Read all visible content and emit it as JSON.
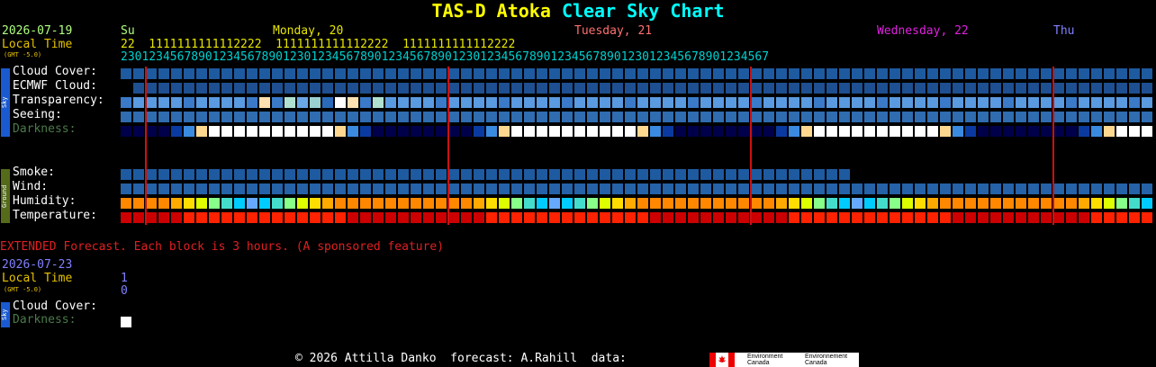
{
  "title": {
    "part1": "TAS-D Atoka",
    "part2": "Clear Sky Chart"
  },
  "header": {
    "date": "2026-07-19",
    "local_time": "Local Time",
    "gmt": "(GMT -5.0)",
    "days": [
      {
        "label": "Su",
        "color": "#b0ff80"
      },
      {
        "label": "Monday, 20",
        "color": "#e6e600"
      },
      {
        "label": "Tuesday, 21",
        "color": "#ff7070"
      },
      {
        "label": "Wednesday, 22",
        "color": "#e020e0"
      },
      {
        "label": "Thu",
        "color": "#8080ff"
      }
    ],
    "tens": "22  1111111111112222  1111111111112222  1111111111112222",
    "units": "23012345678901234567890123012345678901234567890123012345678901234567890123012345678901234567"
  },
  "rows": {
    "sky": [
      {
        "label": "Cloud Cover:",
        "key": "cloud"
      },
      {
        "label": "ECMWF Cloud:",
        "key": "ecmwf"
      },
      {
        "label": "Transparency:",
        "key": "transp"
      },
      {
        "label": "Seeing:",
        "key": "seeing"
      },
      {
        "label": "Darkness:",
        "key": "dark"
      }
    ],
    "ground": [
      {
        "label": "Smoke:",
        "key": "smoke"
      },
      {
        "label": "Wind:",
        "key": "wind"
      },
      {
        "label": "Humidity:",
        "key": "humid"
      },
      {
        "label": "Temperature:",
        "key": "temp"
      }
    ],
    "side_sky": "Sky",
    "side_ground": "Ground"
  },
  "palette": {
    "cloud": "#1e5aa0",
    "ecmwf": "#1e4f90",
    "seeing": "#2f6cb0",
    "smoke": "#1e5aa0",
    "wind": "#2562a8",
    "temp": "#ff2200"
  },
  "extended": {
    "note": "EXTENDED Forecast. Each block is 3 hours. (A sponsored feature)",
    "date": "2026-07-23",
    "local_time": "Local Time",
    "gmt": "(GMT -5.0)",
    "hour_tens": "1",
    "hour_units": "0",
    "cloud_label": "Cloud Cover:",
    "dark_label": "Darkness:",
    "side": "Sky"
  },
  "footer": {
    "text": "© 2026 Attilla Danko  forecast: A.Rahill  data:",
    "logo_en1": "Environment",
    "logo_en2": "Canada",
    "logo_fr1": "Environnement",
    "logo_fr2": "Canada"
  }
}
